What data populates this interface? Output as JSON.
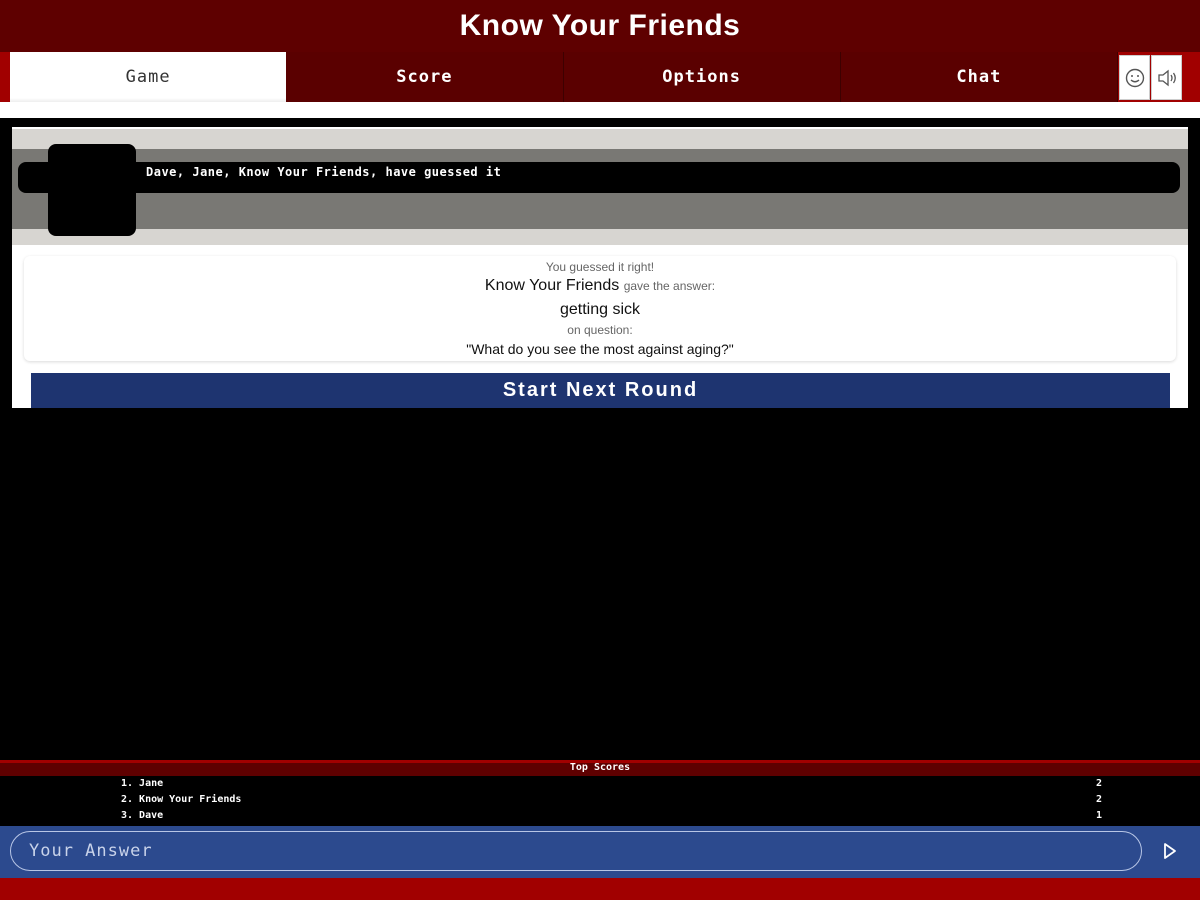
{
  "app": {
    "title": "Know Your Friends"
  },
  "tabs": [
    {
      "label": "Game",
      "active": true
    },
    {
      "label": "Score",
      "active": false
    },
    {
      "label": "Options",
      "active": false
    },
    {
      "label": "Chat",
      "active": false
    }
  ],
  "toolbar": {
    "emoji_icon": "smiley-icon",
    "sound_icon": "speaker-icon"
  },
  "game": {
    "guessed_message": "Dave, Jane, Know Your Friends, have guessed it",
    "result": {
      "status": "You guessed it right!",
      "answerer": "Know Your Friends",
      "gave_text": "gave the answer:",
      "answer": "getting sick",
      "on_question_text": "on question:",
      "question": "\"What do you see the most against aging?\""
    },
    "next_round_label": "Start Next Round"
  },
  "top_scores": {
    "title": "Top Scores",
    "entries": [
      {
        "rank_name": "1. Jane",
        "score": "2"
      },
      {
        "rank_name": "2. Know Your Friends",
        "score": "2"
      },
      {
        "rank_name": "3. Dave",
        "score": "1"
      }
    ]
  },
  "answer_input": {
    "placeholder": "Your Answer",
    "value": ""
  },
  "colors": {
    "header_dark_red": "#5e0000",
    "accent_red": "#a10000",
    "button_blue": "#1e3470",
    "input_bar_blue": "#2c4a8e"
  }
}
